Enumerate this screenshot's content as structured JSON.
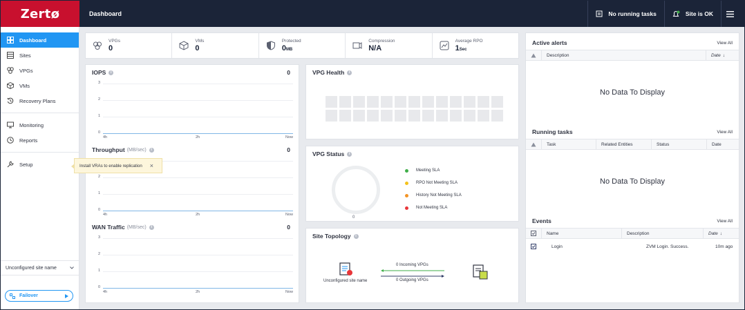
{
  "brand": "Zertø",
  "header": {
    "title": "Dashboard",
    "running_tasks": "No running tasks",
    "site_status": "Site is OK"
  },
  "sidebar": {
    "items": [
      {
        "label": "Dashboard",
        "icon": "dashboard-icon",
        "active": true
      },
      {
        "label": "Sites",
        "icon": "sites-icon"
      },
      {
        "label": "VPGs",
        "icon": "vpgs-icon"
      },
      {
        "label": "VMs",
        "icon": "vms-icon"
      },
      {
        "label": "Recovery Plans",
        "icon": "recovery-plans-icon"
      },
      {
        "label": "Monitoring",
        "icon": "monitor-icon"
      },
      {
        "label": "Reports",
        "icon": "reports-icon"
      },
      {
        "label": "Setup",
        "icon": "wrench-icon"
      }
    ],
    "site_selector": "Unconfigured site name",
    "failover": "Failover"
  },
  "stats": {
    "vpgs": {
      "label": "VPGs",
      "value": "0"
    },
    "vms": {
      "label": "VMs",
      "value": "0"
    },
    "protected": {
      "label": "Protected",
      "value": "0",
      "unit": "MB"
    },
    "compression": {
      "label": "Compression",
      "value": "N/A"
    },
    "rpo": {
      "label": "Average RPO",
      "value": "1",
      "unit": "Sec"
    }
  },
  "iops": {
    "title": "IOPS",
    "value": "0",
    "y_ticks": [
      "3",
      "2",
      "1",
      "0"
    ],
    "x_ticks": [
      "4h",
      "2h",
      "Now"
    ]
  },
  "throughput": {
    "title": "Throughput",
    "unit": "(MB/sec)",
    "value": "0",
    "y_ticks": [
      "3",
      "2",
      "1",
      "0"
    ],
    "x_ticks": [
      "4h",
      "2h",
      "Now"
    ]
  },
  "wan": {
    "title": "WAN Traffic",
    "unit": "(MB/sec)",
    "value": "0",
    "y_ticks": [
      "3",
      "2",
      "1",
      "0"
    ],
    "x_ticks": [
      "4h",
      "2h",
      "Now"
    ]
  },
  "tooltip": {
    "text": "Install VRAs to enable replication",
    "close": "×"
  },
  "vpg_health": {
    "title": "VPG Health"
  },
  "vpg_status": {
    "title": "VPG Status",
    "total": "0",
    "legend": [
      {
        "label": "Meeting SLA",
        "color": "#3fae49"
      },
      {
        "label": "RPO Not Meeting SLA",
        "color": "#f4c21b"
      },
      {
        "label": "History Not Meeting SLA",
        "color": "#f39425"
      },
      {
        "label": "Not Meeting SLA",
        "color": "#e8363a"
      }
    ]
  },
  "topology": {
    "title": "Site Topology",
    "site_name": "Unconfigured site name",
    "incoming": "0 Incoming VPGs",
    "outgoing": "0 Outgoing VPGs"
  },
  "alerts": {
    "title": "Active alerts",
    "view_all": "View All",
    "columns": [
      "Description",
      "Date"
    ],
    "empty": "No Data To Display"
  },
  "tasks": {
    "title": "Running tasks",
    "view_all": "View All",
    "columns": [
      "Task",
      "Related Entities",
      "Status",
      "Date"
    ],
    "empty": "No Data To Display"
  },
  "events": {
    "title": "Events",
    "view_all": "View All",
    "columns": [
      "Name",
      "Description",
      "Date"
    ],
    "rows": [
      {
        "name": "Login",
        "description": "ZVM Login. Success.",
        "date": "10m ago"
      }
    ]
  },
  "colors": {
    "brand": "#c8102e",
    "topbar": "#1b2438",
    "accent": "#2196f3"
  }
}
